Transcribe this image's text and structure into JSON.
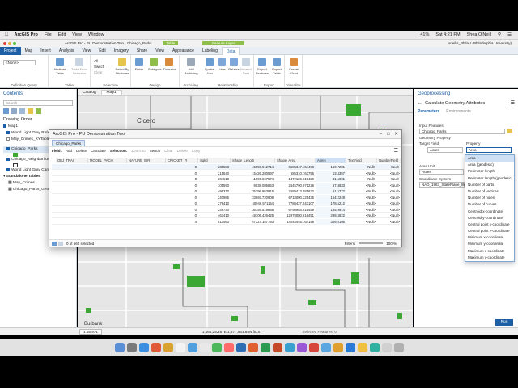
{
  "menubar": {
    "app": "ArcGIS Pro",
    "items": [
      "File",
      "Edit",
      "View",
      "Window"
    ],
    "right": {
      "battery": "41%",
      "time": "Sat 4:21 PM",
      "user": "Shea O'Neill"
    }
  },
  "titlebar": {
    "title": "ArcGIS Pro - PU Demonstration Two",
    "doc": "Chicago_Parks",
    "context_tab": "Table",
    "feature_layer": "Feature Layer",
    "account": "oneills_PhilaU (Philadelphia University)"
  },
  "ribbon_tabs": [
    "Project",
    "Map",
    "Insert",
    "Analysis",
    "View",
    "Edit",
    "Imagery",
    "Share",
    "View",
    "Appearance",
    "Labeling",
    "Data"
  ],
  "ribbon": {
    "groups": [
      {
        "label": "Definition Query",
        "buttons": [
          "<None>"
        ]
      },
      {
        "label": "Table",
        "buttons": [
          "Attribute Table",
          "Table From Selection"
        ]
      },
      {
        "label": "Selection",
        "buttons": [
          "All",
          "Switch",
          "Clear",
          "Select By Attributes"
        ]
      },
      {
        "label": "Design",
        "buttons": [
          "Fields",
          "Subtypes",
          "Domains"
        ]
      },
      {
        "label": "Archiving",
        "buttons": [
          "Add Archiving"
        ]
      },
      {
        "label": "Relationship",
        "buttons": [
          "Spatial Join",
          "Joins",
          "Relates",
          "Related Data"
        ]
      },
      {
        "label": "Export",
        "buttons": [
          "Export Features",
          "Export Table"
        ]
      },
      {
        "label": "Visualize",
        "buttons": [
          "Create Chart"
        ]
      }
    ]
  },
  "contents": {
    "title": "Contents",
    "search_placeholder": "Search",
    "drawing_order": "Drawing Order",
    "items": [
      "Map1",
      "World Light Gray Reference",
      "May_Crimes_XYTableToPoint",
      "Chicago_Parks",
      "Chicago_Neighborhoods",
      "World Light Gray Canvas Base",
      "Standalone Tables",
      "May_Crimes",
      "Chicago_Parks_GeometryAttributes"
    ]
  },
  "map_tabs": [
    "Catalog",
    "Map1"
  ],
  "map_labels": [
    "Cicero",
    "Burbank"
  ],
  "table_window": {
    "title": "ArcGIS Pro - PU Demonstration Two",
    "tab": "Chicago_Parks",
    "toolbar": [
      "Field:",
      "Add",
      "Delete",
      "Calculate",
      "Selection:",
      "Zoom To",
      "Switch",
      "Clear",
      "Delete",
      "Copy"
    ],
    "columns": [
      "OBJ_TRAI",
      "MODEL_PACH",
      "NATURE_BIR",
      "CRICKET_FI",
      "Sqkd",
      "Shape_Length",
      "Shape_Area",
      "Acres",
      "TextField",
      "NumberField"
    ],
    "rows": [
      [
        "0",
        "235583",
        "46998.912714",
        "6585347.454498",
        "150.7281",
        "<Null>",
        "<Null>"
      ],
      [
        "0",
        "215540",
        "15426.280597",
        "585310.763755",
        "13.4357",
        "<Null>",
        "<Null>"
      ],
      [
        "0",
        "204510",
        "11096.667574",
        "1372126.819429",
        "31.5001",
        "<Null>",
        "<Null>"
      ],
      [
        "0",
        "105590",
        "9038.085863",
        "2645790.071226",
        "57.8633",
        "<Null>",
        "<Null>"
      ],
      [
        "0",
        "496310",
        "35296.953815",
        "2689413.881632",
        "61.5772",
        "<Null>",
        "<Null>"
      ],
      [
        "0",
        "240985",
        "33693.720908",
        "6718000.225435",
        "154.2249",
        "<Null>",
        "<Null>"
      ],
      [
        "0",
        "276410",
        "40946.571154",
        "7788427.843107",
        "178.5212",
        "<Null>",
        "<Null>"
      ],
      [
        "0",
        "248740",
        "36755.519868",
        "6798984.618459",
        "155.9914",
        "<Null>",
        "<Null>"
      ],
      [
        "0",
        "463410",
        "49106.426425",
        "12978080.818451",
        "298.5822",
        "<Null>",
        "<Null>"
      ],
      [
        "4",
        "513460",
        "57327.187793",
        "14244445.164158",
        "326.0166",
        "<Null>",
        "<Null>"
      ]
    ],
    "selected_count": "0 of 560 selected",
    "filters": "Filters:",
    "zoom": "100 %"
  },
  "geoprocessing": {
    "pane_title": "Geoprocessing",
    "tool_title": "Calculate Geometry Attributes",
    "tabs": [
      "Parameters",
      "Environments"
    ],
    "input_label": "Input Features",
    "input_value": "Chicago_Parks",
    "geom_props_label": "Geometry Property",
    "target_field_label": "Target Field",
    "property_label": "Property",
    "target_field_value": "Acres",
    "property_value": "Area",
    "area_unit_label": "Area Unit",
    "area_unit_value": "Acres",
    "crs_label": "Coordinate System",
    "crs_value": "NAD_1983_StatePlane_Illinois",
    "run": "Run",
    "bottom_tabs": [
      "Catalog",
      "Geoprocessing"
    ]
  },
  "dropdown_options": [
    "Area",
    "Area (geodesic)",
    "Perimeter length",
    "Perimeter length (geodesic)",
    "Number of parts",
    "Number of vertices",
    "Number of holes",
    "Number of curves",
    "Centroid x-coordinate",
    "Centroid y-coordinate",
    "Central point x-coordinate",
    "Central point y-coordinate",
    "Minimum x-coordinate",
    "Minimum y-coordinate",
    "Maximum x-coordinate",
    "Maximum y-coordinate"
  ],
  "statusbar": {
    "scale": "1:65,971",
    "coords": "1,164,253.67E 1,877,931.84N ftUS",
    "selected": "Selected Features: 0"
  },
  "colors": {
    "accent": "#1d5fa7",
    "park_green": "#3aa832",
    "map_bg": "#e8e8e8"
  }
}
